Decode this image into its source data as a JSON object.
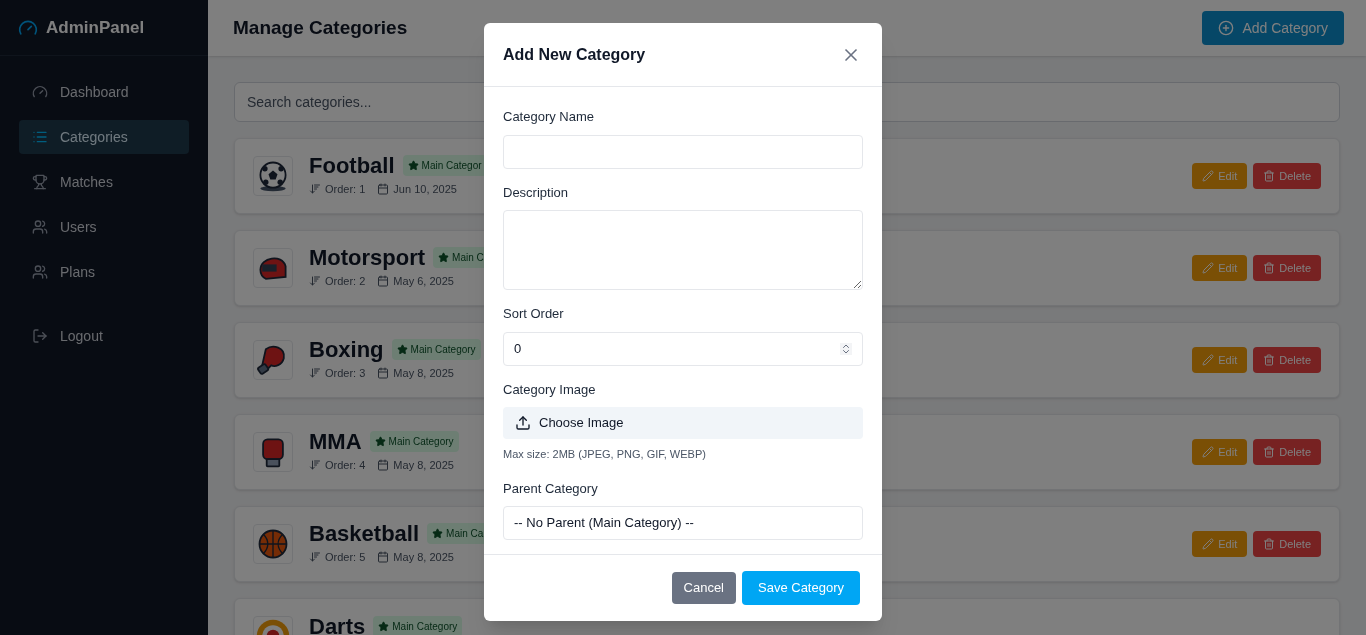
{
  "sidebar": {
    "brand": "AdminPanel",
    "items": [
      {
        "label": "Dashboard",
        "selected": false
      },
      {
        "label": "Categories",
        "selected": true
      },
      {
        "label": "Matches",
        "selected": false
      },
      {
        "label": "Users",
        "selected": false
      },
      {
        "label": "Plans",
        "selected": false
      }
    ],
    "logout": "Logout"
  },
  "header": {
    "title": "Manage Categories",
    "add_button": "Add Category"
  },
  "search": {
    "placeholder": "Search categories..."
  },
  "categories": [
    {
      "name": "Football",
      "badge": "Main Categor",
      "order": "Order: 1",
      "date": "Jun 10, 2025",
      "edit": "Edit",
      "delete": "Delete"
    },
    {
      "name": "Motorsport",
      "badge": "Main C",
      "order": "Order: 2",
      "date": "May 6, 2025",
      "edit": "Edit",
      "delete": "Delete"
    },
    {
      "name": "Boxing",
      "badge": "Main Category",
      "order": "Order: 3",
      "date": "May 8, 2025",
      "edit": "Edit",
      "delete": "Delete"
    },
    {
      "name": "MMA",
      "badge": "Main Category",
      "order": "Order: 4",
      "date": "May 8, 2025",
      "edit": "Edit",
      "delete": "Delete"
    },
    {
      "name": "Basketball",
      "badge": "Main Ca",
      "order": "Order: 5",
      "date": "May 8, 2025",
      "edit": "Edit",
      "delete": "Delete"
    },
    {
      "name": "Darts",
      "badge": "Main Category"
    }
  ],
  "modal": {
    "title": "Add New Category",
    "name_label": "Category Name",
    "description_label": "Description",
    "sort_label": "Sort Order",
    "sort_value": "0",
    "image_label": "Category Image",
    "image_button": "Choose Image",
    "image_hint": "Max size: 2MB (JPEG, PNG, GIF, WEBP)",
    "parent_label": "Parent Category",
    "parent_value": "-- No Parent (Main Category) --",
    "cancel": "Cancel",
    "save": "Save Category"
  }
}
